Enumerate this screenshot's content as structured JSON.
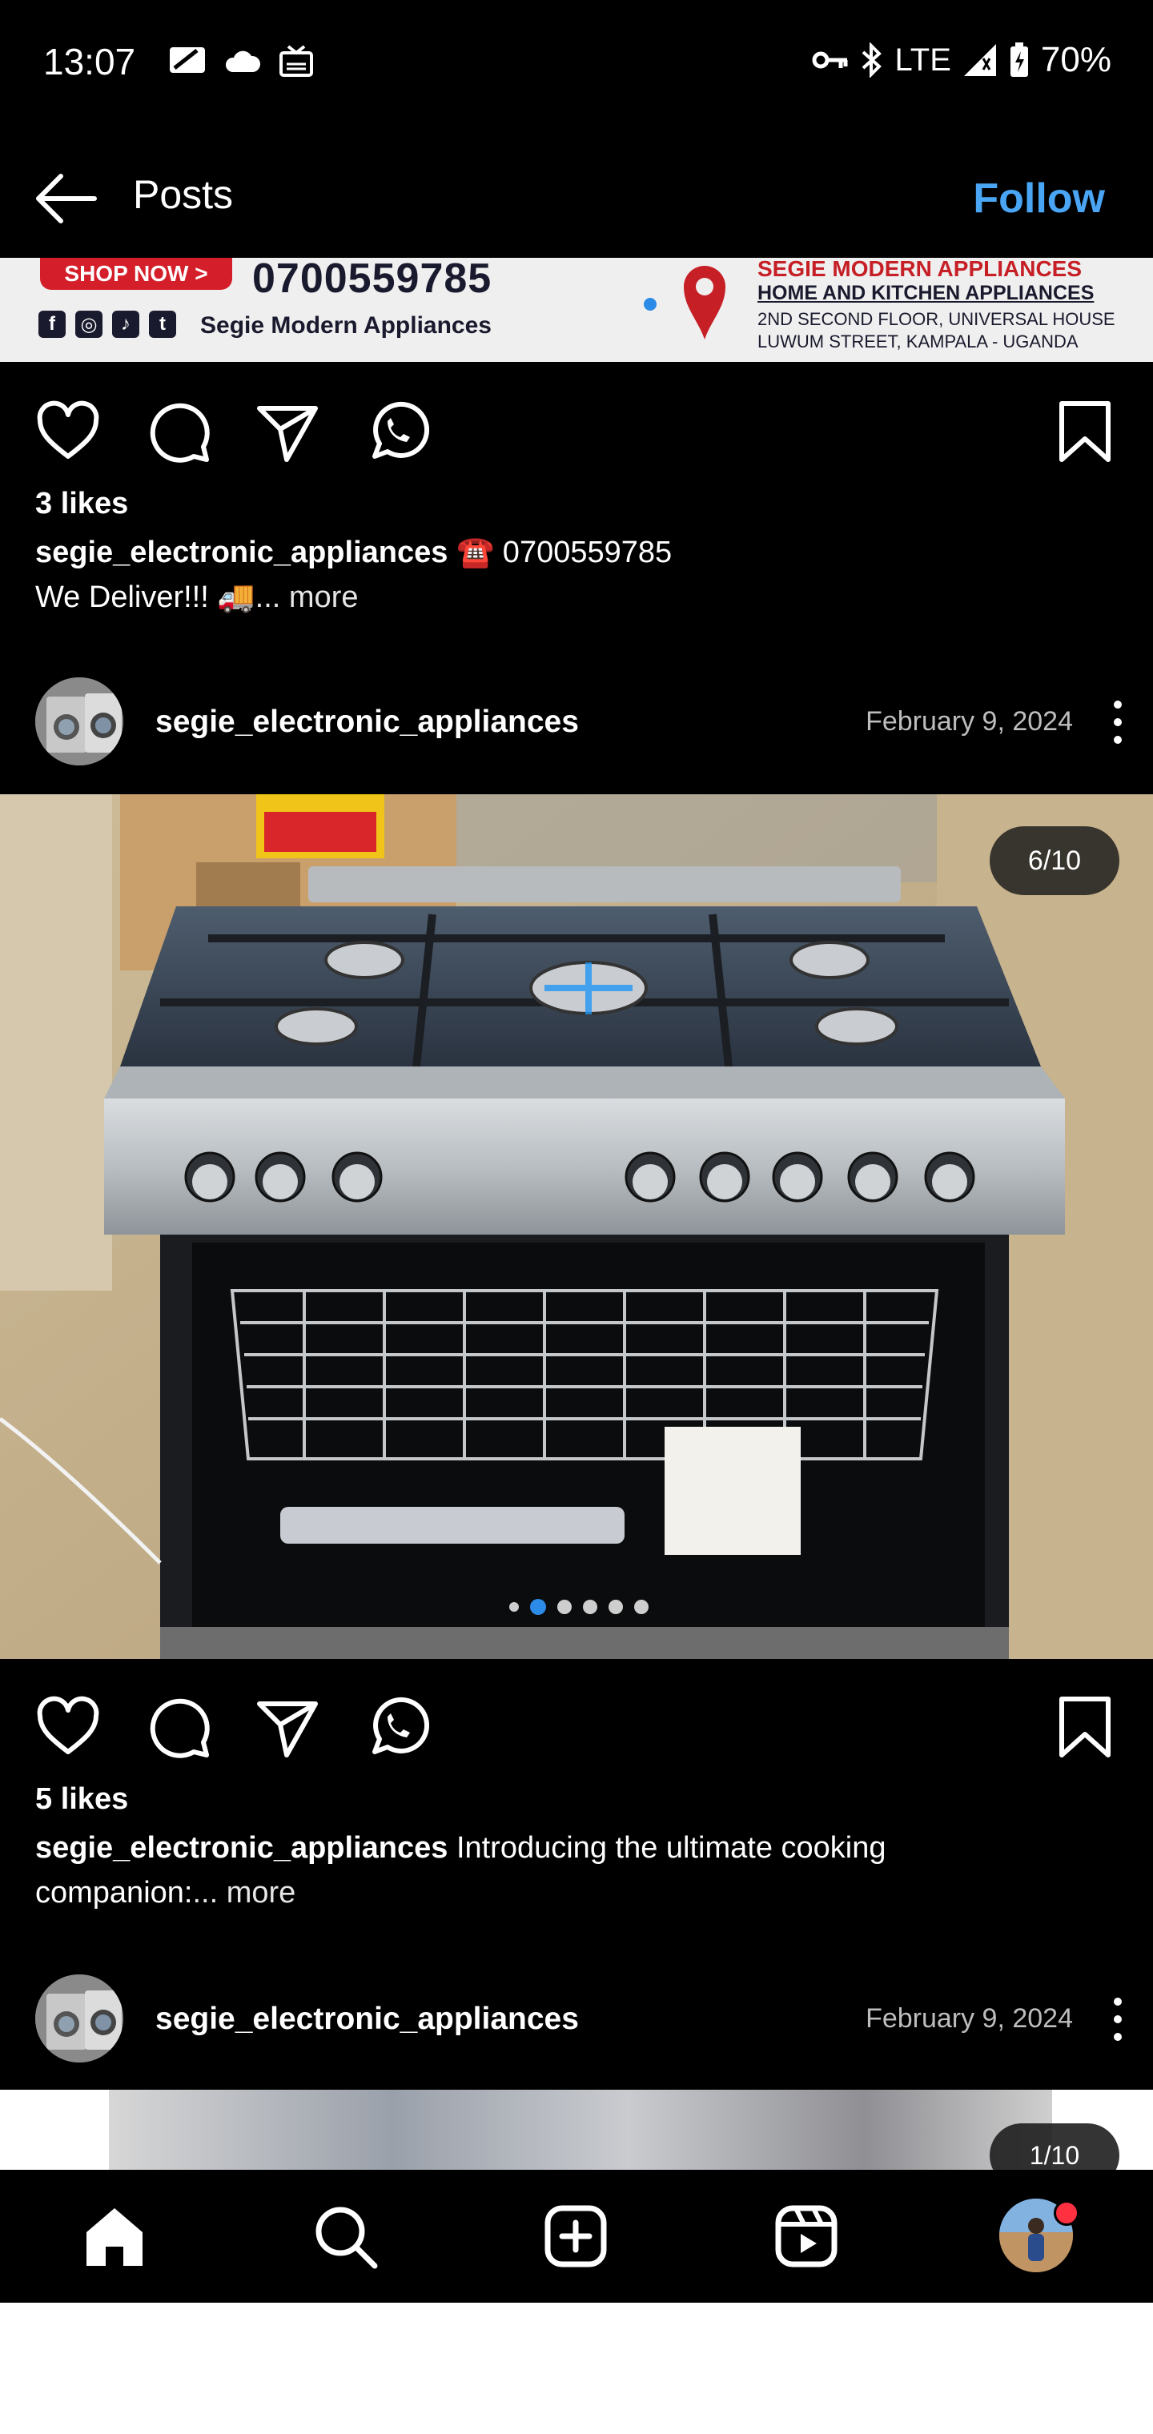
{
  "status_bar": {
    "time": "13:07",
    "network": "LTE",
    "battery": "70%"
  },
  "header": {
    "title": "Posts",
    "follow_label": "Follow"
  },
  "banner": {
    "shop_now": "SHOP NOW >",
    "phone": "0700559785",
    "name": "Segie Modern Appliances",
    "company": "SEGIE MODERN APPLIANCES",
    "subtitle": "HOME AND KITCHEN APPLIANCES",
    "address1": "2ND SECOND FLOOR, UNIVERSAL HOUSE",
    "address2": "LUWUM STREET, KAMPALA - UGANDA"
  },
  "post1": {
    "likes": "3 likes",
    "username": "segie_electronic_appliances",
    "caption": "☎️ 0700559785",
    "caption_line2": "We Deliver!!! 🚚",
    "more": "... more"
  },
  "post2": {
    "username": "segie_electronic_appliances",
    "date": "February 9, 2024",
    "counter": "6/10",
    "likes": "5 likes",
    "caption_user": "segie_electronic_appliances",
    "caption": "Introducing the ultimate cooking",
    "caption_line2": "companion:",
    "more": "... more"
  },
  "post3": {
    "username": "segie_electronic_appliances",
    "date": "February 9, 2024",
    "counter": "1/10"
  },
  "icons": {
    "back": "arrow-left-icon",
    "like": "heart-icon",
    "comment": "comment-icon",
    "share": "send-icon",
    "whatsapp": "whatsapp-icon",
    "save": "bookmark-icon",
    "more": "more-vertical-icon",
    "home": "home-icon",
    "search": "search-icon",
    "create": "add-square-icon",
    "reels": "reels-icon"
  },
  "colors": {
    "background": "#000000",
    "accent": "#4aa6f5",
    "notification": "#ff3040"
  }
}
